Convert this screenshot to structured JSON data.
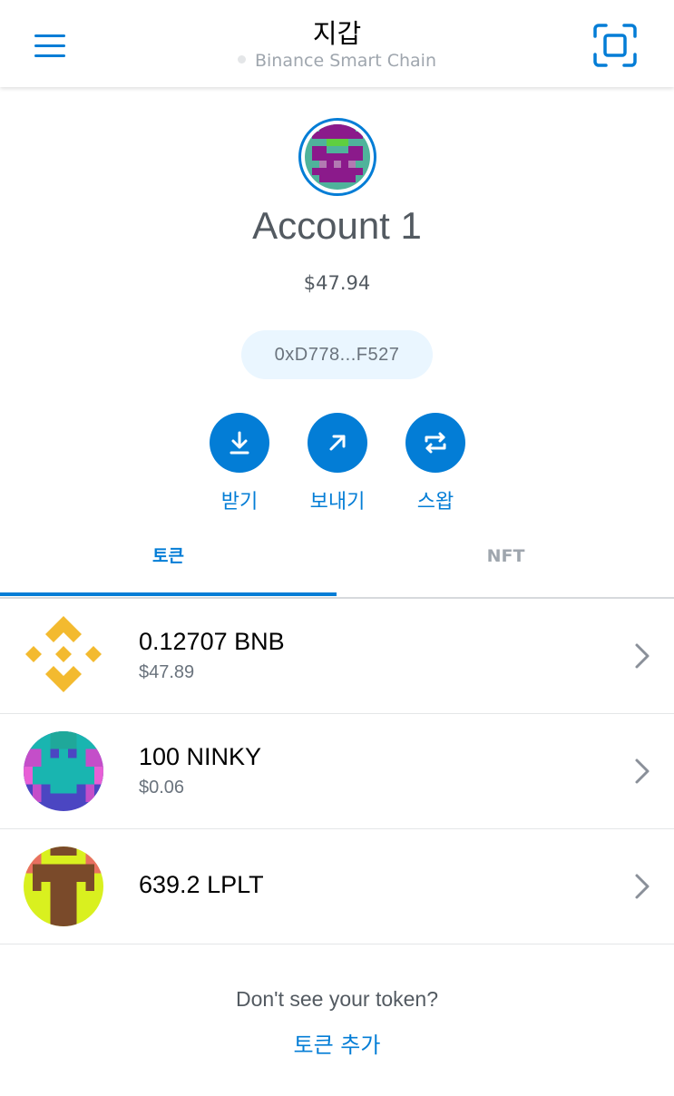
{
  "header": {
    "title": "지갑",
    "network": "Binance Smart Chain"
  },
  "account": {
    "name": "Account 1",
    "balance": "$47.94",
    "address": "0xD778...F527"
  },
  "actions": {
    "receive": "받기",
    "send": "보내기",
    "swap": "스왑"
  },
  "tabs": {
    "tokens": "토큰",
    "nft": "NFT"
  },
  "tokens": [
    {
      "amount": "0.12707 BNB",
      "fiat": "$47.89",
      "icon": "bnb-icon"
    },
    {
      "amount": "100 NINKY",
      "fiat": "$0.06",
      "icon": "ninky-identicon"
    },
    {
      "amount": "639.2 LPLT",
      "fiat": "",
      "icon": "lplt-identicon"
    }
  ],
  "footer": {
    "prompt": "Don't see your token?",
    "add_token": "토큰 추가"
  },
  "colors": {
    "primary": "#037dd6",
    "bnb": "#f3ba2f"
  }
}
